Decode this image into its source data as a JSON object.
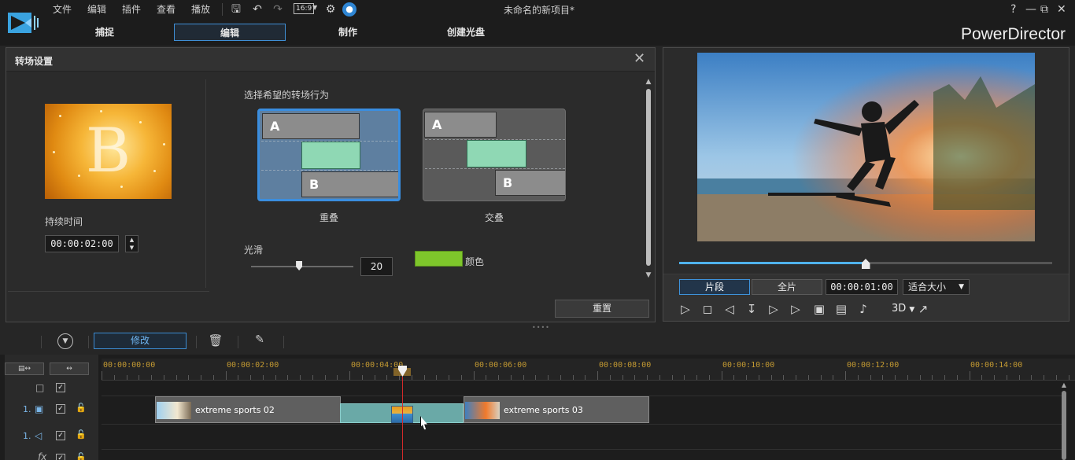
{
  "menu": [
    "文件",
    "编辑",
    "插件",
    "查看",
    "播放"
  ],
  "toolbar": {
    "aspect_ratio": "16:9"
  },
  "window_title": "未命名的新项目*",
  "window_controls": {
    "help": "?",
    "minimize": "—",
    "restore": "⧉",
    "close": "✕"
  },
  "mode_tabs": [
    {
      "label": "捕捉",
      "active": false
    },
    {
      "label": "编辑",
      "active": true
    },
    {
      "label": "制作",
      "active": false
    },
    {
      "label": "创建光盘",
      "active": false
    }
  ],
  "brand": "PowerDirector",
  "transition_panel": {
    "title": "转场设置",
    "thumbnail_letter": "B",
    "duration_label": "持续时间",
    "duration_value": "00:00:02:00",
    "behavior_label": "选择希望的转场行为",
    "behaviors": [
      {
        "label": "重叠",
        "selected": true,
        "lane_a": "A",
        "lane_b": "B"
      },
      {
        "label": "交叠",
        "selected": false,
        "lane_a": "A",
        "lane_b": "B"
      }
    ],
    "smooth_label": "光滑",
    "smooth_value": "20",
    "smooth_fraction": 0.47,
    "color_label": "颜色",
    "color_value": "#7ec62b",
    "reset_label": "重置"
  },
  "preview": {
    "progress_fraction": 0.5,
    "clip_button": "片段",
    "full_button": "全片",
    "timecode": "00:00:01:00",
    "fit_label": "适合大小",
    "three_d_label": "3D"
  },
  "edit_toolbar": {
    "modify_label": "修改"
  },
  "timeline": {
    "ruler_labels": [
      "00:00:00:00",
      "00:00:02:00",
      "00:00:04:00",
      "00:00:06:00",
      "00:00:08:00",
      "00:00:10:00",
      "00:00:12:00",
      "00:00:14:00"
    ],
    "video_track_number": "1.",
    "audio_track_number": "1.",
    "fx_label": "fx",
    "clips": [
      {
        "name": "extreme sports 02"
      },
      {
        "name": "extreme sports 03"
      }
    ]
  },
  "colors": {
    "accent": "#3f8fd6",
    "timecode": "#c49a32",
    "playhead": "#d22a2a"
  }
}
